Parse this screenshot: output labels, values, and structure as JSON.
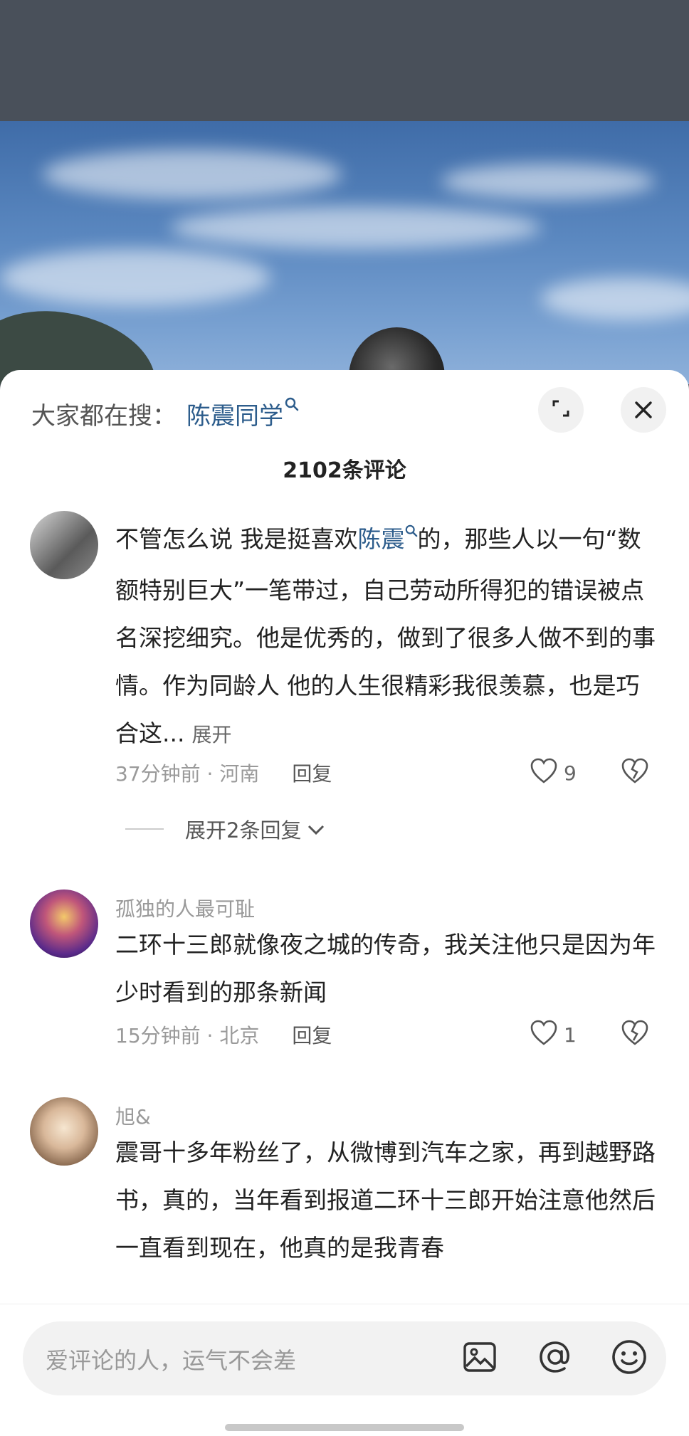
{
  "search_hint": {
    "prefix": "大家都在搜：",
    "term": "陈震同学"
  },
  "comments_header": {
    "count_label": "2102条评论"
  },
  "comments": [
    {
      "username": "",
      "text_before": "不管怎么说 我是挺喜欢",
      "keyword": "陈震",
      "text_after": "的，那些人以一句“数额特别巨大”一笔带过，自己劳动所得犯的错误被点名深挖细究。他是优秀的，做到了很多人做不到的事情。作为同龄人 他的人生很精彩我很羡慕，也是巧合这...",
      "more_label": "展开",
      "time_location": "37分钟前 · 河南",
      "reply_label": "回复",
      "likes": "9",
      "expand_replies_label": "展开2条回复"
    },
    {
      "username": "孤独的人最可耻",
      "text": "二环十三郎就像夜之城的传奇，我关注他只是因为年少时看到的那条新闻",
      "time_location": "15分钟前 · 北京",
      "reply_label": "回复",
      "likes": "1"
    },
    {
      "username": "旭&",
      "text": "震哥十多年粉丝了，从微博到汽车之家，再到越野路书，真的，当年看到报道二环十三郎开始注意他然后一直看到现在，他真的是我青春"
    }
  ],
  "input": {
    "placeholder": "爱评论的人，运气不会差"
  },
  "colors": {
    "keyword_blue": "#2d5d8c",
    "muted_gray": "#9a9a9a"
  }
}
